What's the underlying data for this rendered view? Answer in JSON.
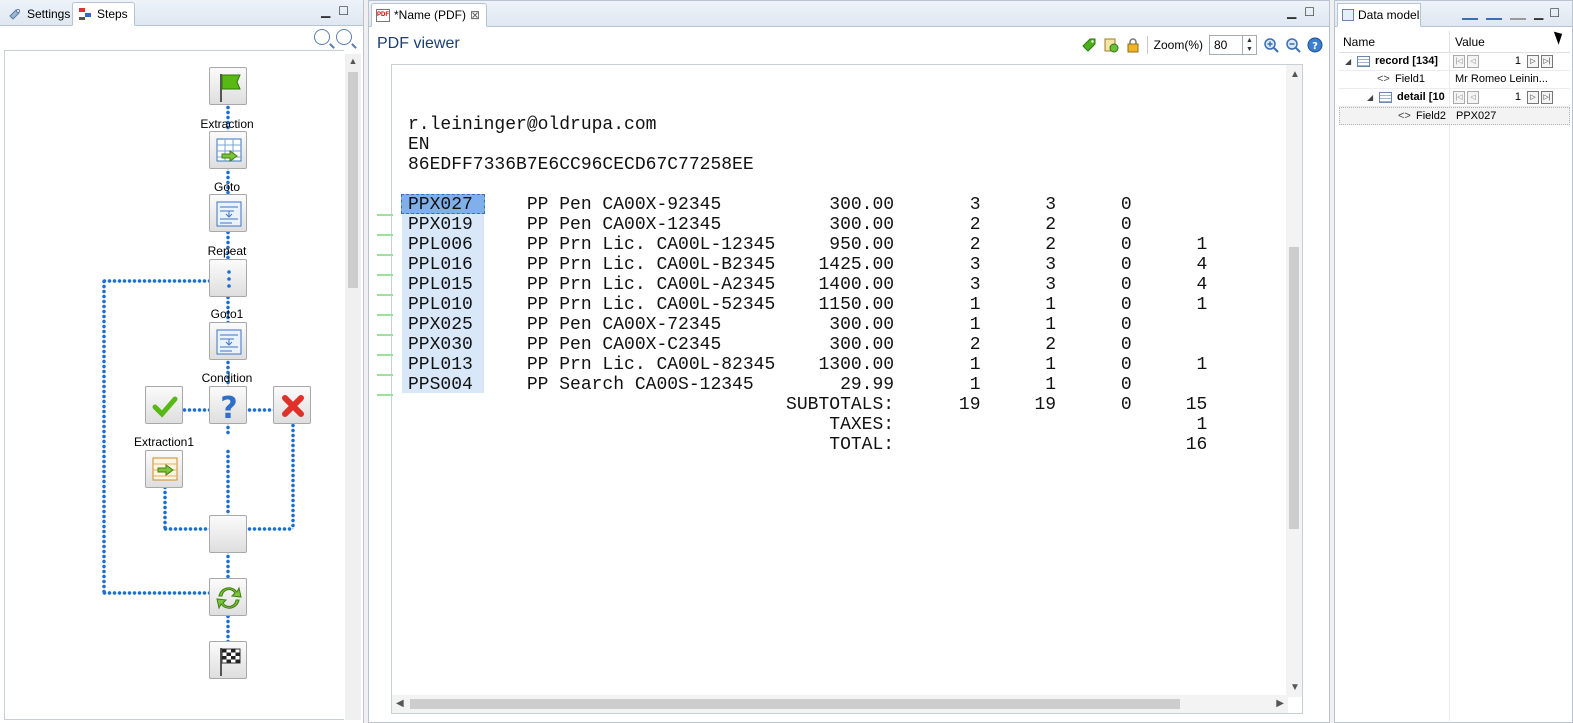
{
  "left_panel": {
    "tabs": [
      {
        "label": "Settings",
        "icon": "settings-icon",
        "active": false
      },
      {
        "label": "Steps",
        "icon": "steps-icon",
        "active": true
      }
    ],
    "minimize": "▁",
    "maximize": "☐",
    "nodes": [
      {
        "name": "start",
        "label": "",
        "icon": "green-flag-icon"
      },
      {
        "name": "extraction",
        "label": "Extraction",
        "icon": "extraction-icon"
      },
      {
        "name": "goto",
        "label": "Goto",
        "icon": "goto-icon"
      },
      {
        "name": "repeat",
        "label": "Repeat",
        "icon": "repeat-icon"
      },
      {
        "name": "goto1",
        "label": "Goto1",
        "icon": "goto-icon"
      },
      {
        "name": "condition",
        "label": "Condition",
        "icon": "question-icon"
      },
      {
        "name": "true-branch",
        "label": "",
        "icon": "checkmark-icon"
      },
      {
        "name": "false-branch",
        "label": "",
        "icon": "red-x-icon"
      },
      {
        "name": "extraction1",
        "label": "Extraction1",
        "icon": "extraction-icon"
      },
      {
        "name": "merge",
        "label": "",
        "icon": "merge-icon"
      },
      {
        "name": "loop",
        "label": "",
        "icon": "loop-arrows-icon"
      },
      {
        "name": "end",
        "label": "",
        "icon": "checkered-flag-icon"
      }
    ]
  },
  "editor": {
    "tab_label": "*Name (PDF)",
    "tab_close": "⊠",
    "viewer_title": "PDF viewer",
    "zoom_label": "Zoom(%)",
    "zoom_value": "80",
    "pdf_lines": [
      "r.leininger@oldrupa.com",
      "EN",
      "86EDFF7336B7E6CC96CECD67C77258EE",
      "",
      "PPX027     PP Pen CA00X-92345          300.00       3      3      0",
      "PPX019     PP Pen CA00X-12345          300.00       2      2      0",
      "PPL006     PP Prn Lic. CA00L-12345     950.00       2      2      0      1",
      "PPL016     PP Prn Lic. CA00L-B2345    1425.00       3      3      0      4",
      "PPL015     PP Prn Lic. CA00L-A2345    1400.00       3      3      0      4",
      "PPL010     PP Prn Lic. CA00L-52345    1150.00       1      1      0      1",
      "PPX025     PP Pen CA00X-72345          300.00       1      1      0",
      "PPX030     PP Pen CA00X-C2345          300.00       2      2      0",
      "PPL013     PP Prn Lic. CA00L-82345    1300.00       1      1      0      1",
      "PPS004     PP Search CA00S-12345        29.99       1      1      0",
      "                                   SUBTOTALS:      19     19      0     15",
      "                                       TAXES:                            1",
      "                                       TOTAL:                           16"
    ]
  },
  "data_model": {
    "tab_label": "Data model",
    "col_name": "Name",
    "col_value": "Value",
    "rows": [
      {
        "indent": 0,
        "expander": "◢",
        "type": "table",
        "name": "record [134]",
        "value": "",
        "pager_value": "1",
        "bold": true
      },
      {
        "indent": 1,
        "expander": "",
        "type": "field",
        "name": "Field1",
        "value": "Mr Romeo Leinin...",
        "pager_value": "",
        "bold": false
      },
      {
        "indent": 1,
        "expander": "◢",
        "type": "table",
        "name": "detail [10",
        "value": "",
        "pager_value": "1",
        "bold": true
      },
      {
        "indent": 2,
        "expander": "",
        "type": "field",
        "name": "Field2",
        "value": "PPX027",
        "pager_value": "",
        "bold": false
      }
    ]
  },
  "colors": {
    "flow_dots": "#1e6fd0",
    "selection": "#7fb0ea",
    "column_highlight": "#d9e8f8",
    "title_blue": "#1d3f6e"
  }
}
